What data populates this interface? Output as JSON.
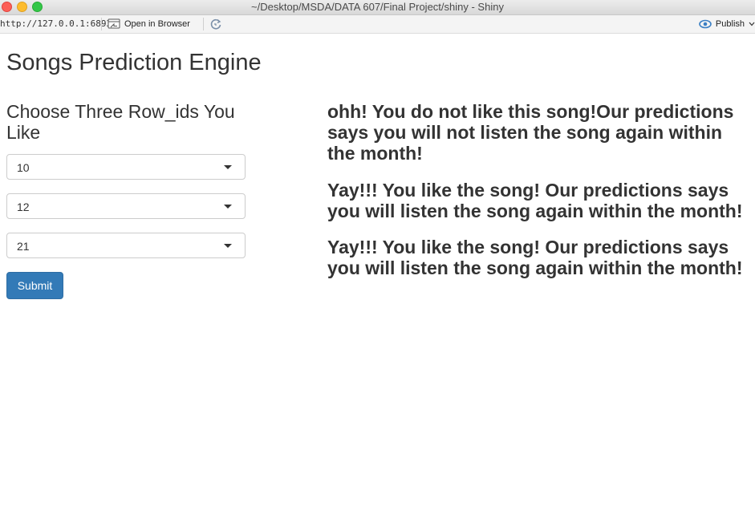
{
  "window": {
    "title": "~/Desktop/MSDA/DATA 607/Final Project/shiny - Shiny"
  },
  "toolbar": {
    "url": "http://127.0.0.1:6893",
    "open_in_browser_label": "Open in Browser",
    "publish_label": "Publish",
    "publish_icon": "publish-icon",
    "refresh_icon": "refresh-icon",
    "browser_icon": "browser-window-icon"
  },
  "app": {
    "title": "Songs Prediction Engine",
    "prompt": "Choose Three Row_ids You Like",
    "selects": [
      {
        "value": "10"
      },
      {
        "value": "12"
      },
      {
        "value": "21"
      }
    ],
    "submit_label": "Submit",
    "results": [
      "ohh! You do not like this song!Our predictions says you will not listen the song again within the month!",
      "Yay!!! You like the song! Our predictions says you will listen the song again within the month!",
      "Yay!!! You like the song! Our predictions says you will listen the song again within the month!"
    ]
  },
  "colors": {
    "submit_bg": "#337ab7",
    "text": "#333333"
  }
}
